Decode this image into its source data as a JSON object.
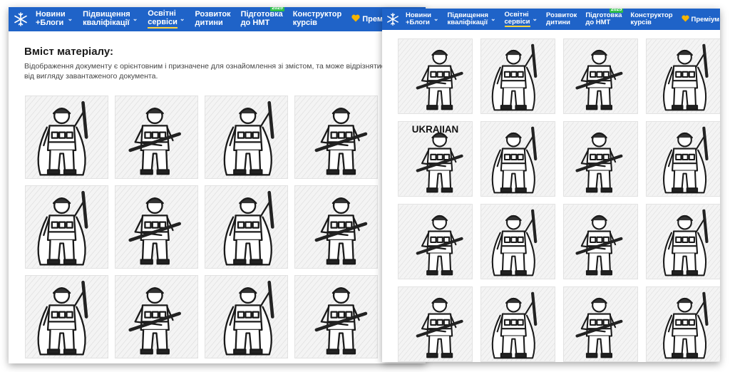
{
  "nav": {
    "items": [
      {
        "label_line1": "Новини",
        "label_line2": "+Блоги",
        "has_dropdown": true
      },
      {
        "label_line1": "Підвищення",
        "label_line2": "кваліфікації",
        "has_dropdown": true
      },
      {
        "label_line1": "Освітні",
        "label_line2": "сервіси",
        "has_dropdown": true,
        "active": true
      },
      {
        "label_line1": "Розвиток",
        "label_line2": "дитини",
        "has_dropdown": false
      },
      {
        "label_line1": "Підготовка",
        "label_line2": "до НМТ",
        "badge": "2025"
      },
      {
        "label_line1": "Конструктор",
        "label_line2": "курсів",
        "has_dropdown": false
      }
    ],
    "premium_label": "Преміум",
    "premium_icon": "yellow-heart-icon",
    "logo_icon": "snowflake-logo-icon"
  },
  "content": {
    "title": "Вміст матеріалу:",
    "description": "Відображення документу є орієнтовним і призначене для ознайомлення зі змістом, та може відрізнятися від вигляду завантаженого документа."
  },
  "thumbnails": {
    "left_count": 12,
    "right_count": 16,
    "right_banner_text": "UKRAIIAN"
  },
  "colors": {
    "nav_bg": "#1f63c8",
    "active_underline": "#ffd43b",
    "badge_bg": "#2fbf4a",
    "heart": "#f5b400"
  }
}
